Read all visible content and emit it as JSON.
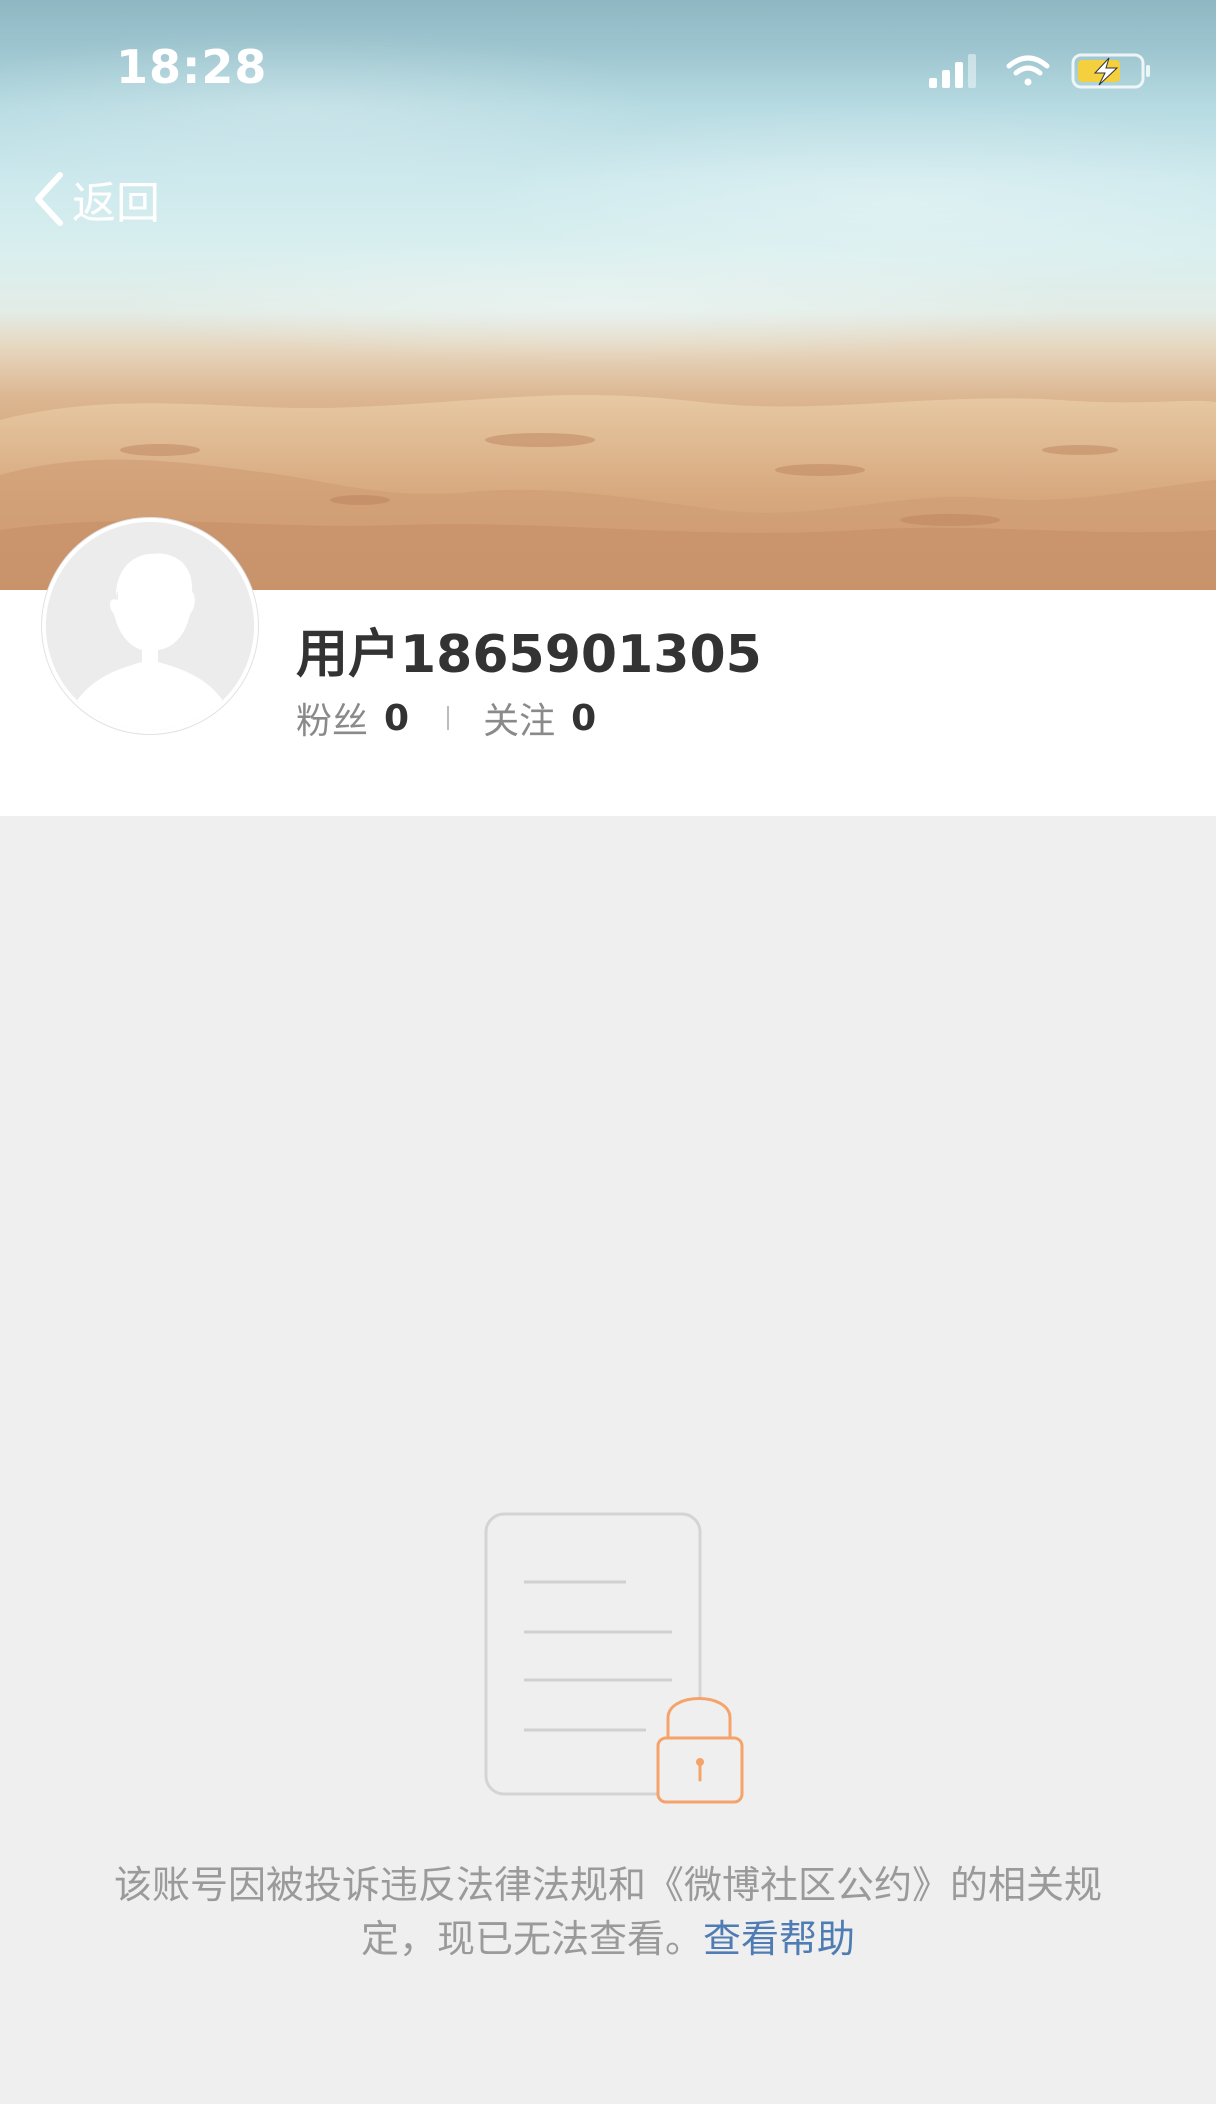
{
  "status_bar": {
    "time": "18:28",
    "icons": [
      "signal-icon",
      "wifi-icon",
      "battery-charging-icon"
    ],
    "battery_color": "#f4d03f"
  },
  "nav": {
    "back_label": "返回",
    "back_icon": "chevron-left-icon"
  },
  "profile": {
    "username": "用户1865901305",
    "followers_label": "粉丝",
    "followers_count": "0",
    "following_label": "关注",
    "following_count": "0",
    "avatar_icon": "default-avatar-icon"
  },
  "restriction": {
    "illustration_icon": "locked-document-icon",
    "message": "该账号因被投诉违反法律法规和《微博社区公约》的相关规定，现已无法查看。",
    "help_link": "查看帮助",
    "link_color": "#4f7db3",
    "lock_color": "#f5a36a"
  }
}
